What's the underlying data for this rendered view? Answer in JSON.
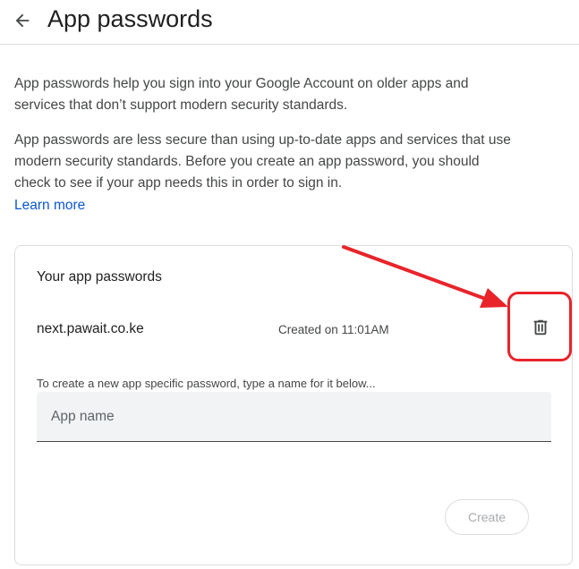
{
  "header": {
    "title": "App passwords",
    "back_icon": "arrow-back-icon"
  },
  "intro": {
    "paragraph1": "App passwords help you sign into your Google Account on older apps and services that don’t support modern security standards.",
    "paragraph2": "App passwords are less secure than using up-to-date apps and services that use modern security standards. Before you create an app password, you should check to see if your app needs this in order to sign in.",
    "learn_more": "Learn more"
  },
  "card": {
    "heading": "Your app passwords",
    "passwords": [
      {
        "name": "next.pawait.co.ke",
        "created": "Created on 11:01AM"
      }
    ],
    "instruction": "To create a new app specific password, type a name for it below...",
    "input_placeholder": "App name",
    "input_value": "",
    "create_label": "Create"
  },
  "colors": {
    "link": "#0b57d0",
    "annotation": "#e8242a"
  }
}
